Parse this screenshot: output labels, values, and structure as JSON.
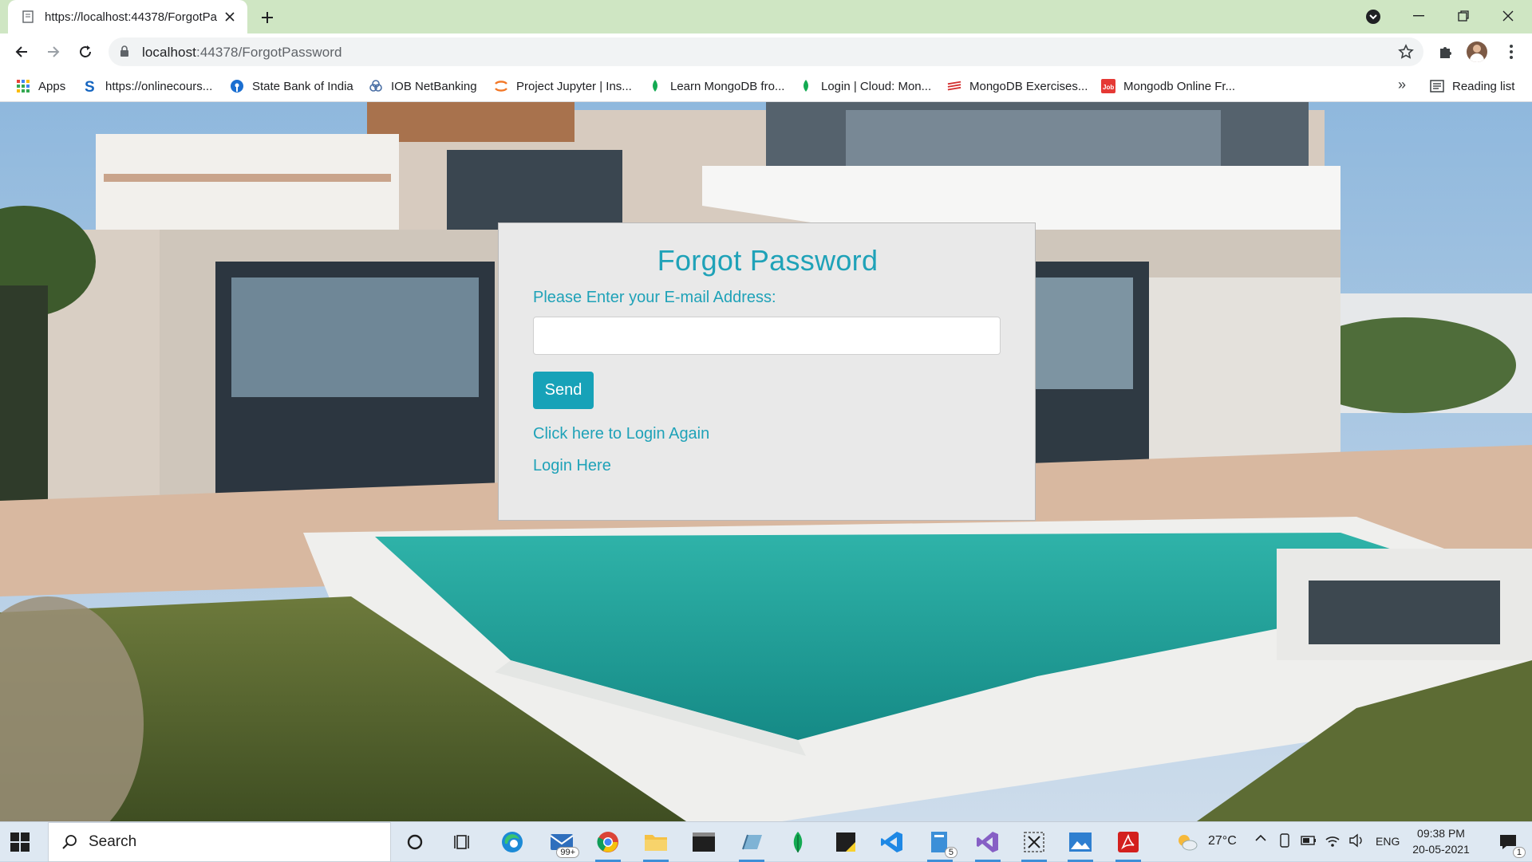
{
  "browser": {
    "tab_title": "https://localhost:44378/ForgotPa",
    "url_host": "localhost",
    "url_rest": ":44378/ForgotPassword",
    "bookmarks": [
      {
        "label": "Apps",
        "icon": "apps-grid-icon",
        "color": "#1a73e8"
      },
      {
        "label": "https://onlinecours...",
        "icon": "s-logo-icon",
        "color": "#1565c0"
      },
      {
        "label": "State Bank of India",
        "icon": "sbi-logo-icon",
        "color": "#1b6fd1"
      },
      {
        "label": "IOB NetBanking",
        "icon": "iob-logo-icon",
        "color": "#4a6fa5"
      },
      {
        "label": "Project Jupyter | Ins...",
        "icon": "jupyter-logo-icon",
        "color": "#f37726"
      },
      {
        "label": "Learn MongoDB fro...",
        "icon": "mongodb-leaf-icon",
        "color": "#13aa52"
      },
      {
        "label": "Login | Cloud: Mon...",
        "icon": "mongodb-leaf-icon",
        "color": "#13aa52"
      },
      {
        "label": "MongoDB Exercises...",
        "icon": "w3resource-logo-icon",
        "color": "#d32f2f"
      },
      {
        "label": "Mongodb Online Fr...",
        "icon": "job-logo-icon",
        "color": "#e53935"
      }
    ],
    "bookmarks_more": "»",
    "reading_list": "Reading list"
  },
  "form": {
    "title": "Forgot Password",
    "email_label": "Please Enter your E-mail Address:",
    "email_value": "",
    "email_placeholder": "",
    "send_label": "Send",
    "login_again_link": "Click here to Login Again",
    "login_here_link": "Login Here",
    "accent_color": "#17a2b8",
    "card_color": "#e9e9e9"
  },
  "taskbar": {
    "search_label": "Search",
    "mail_badge": "99+",
    "files_badge": "5",
    "weather": "27°C",
    "language": "ENG",
    "time": "09:38 PM",
    "date": "20-05-2021",
    "notification_count": "1"
  }
}
